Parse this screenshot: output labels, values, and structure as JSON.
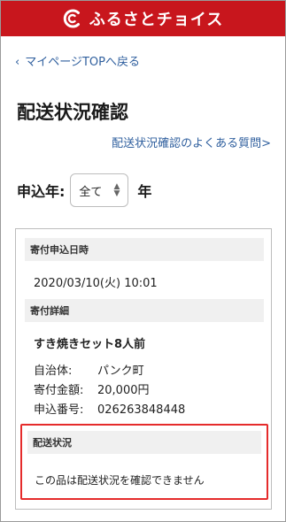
{
  "header": {
    "logo_text": "ふるさとチョイス",
    "brand_color": "#c8161d",
    "logo_icon": "furusato-choice-c-logo-icon"
  },
  "nav": {
    "back_chevron": "‹",
    "back_label": "マイページTOPへ戻る"
  },
  "page": {
    "title": "配送状況確認",
    "faq_link": "配送状況確認のよくある質問>"
  },
  "filter": {
    "year_label": "申込年:",
    "year_selected": "全て",
    "year_suffix": "年"
  },
  "donation": {
    "date_heading": "寄付申込日時",
    "date_value": "2020/03/10(火) 10:01",
    "detail_heading": "寄付詳細",
    "product_name": "すき焼きセット8人前",
    "municipality_label": "自治体:",
    "municipality_value": "パンク町",
    "amount_label": "寄付金額:",
    "amount_value": "20,000円",
    "application_label": "申込番号:",
    "application_value": "026263848448"
  },
  "delivery": {
    "heading": "配送状況",
    "status_text": "この品は配送状況を確認できません",
    "highlight_color": "#e52b2b"
  }
}
